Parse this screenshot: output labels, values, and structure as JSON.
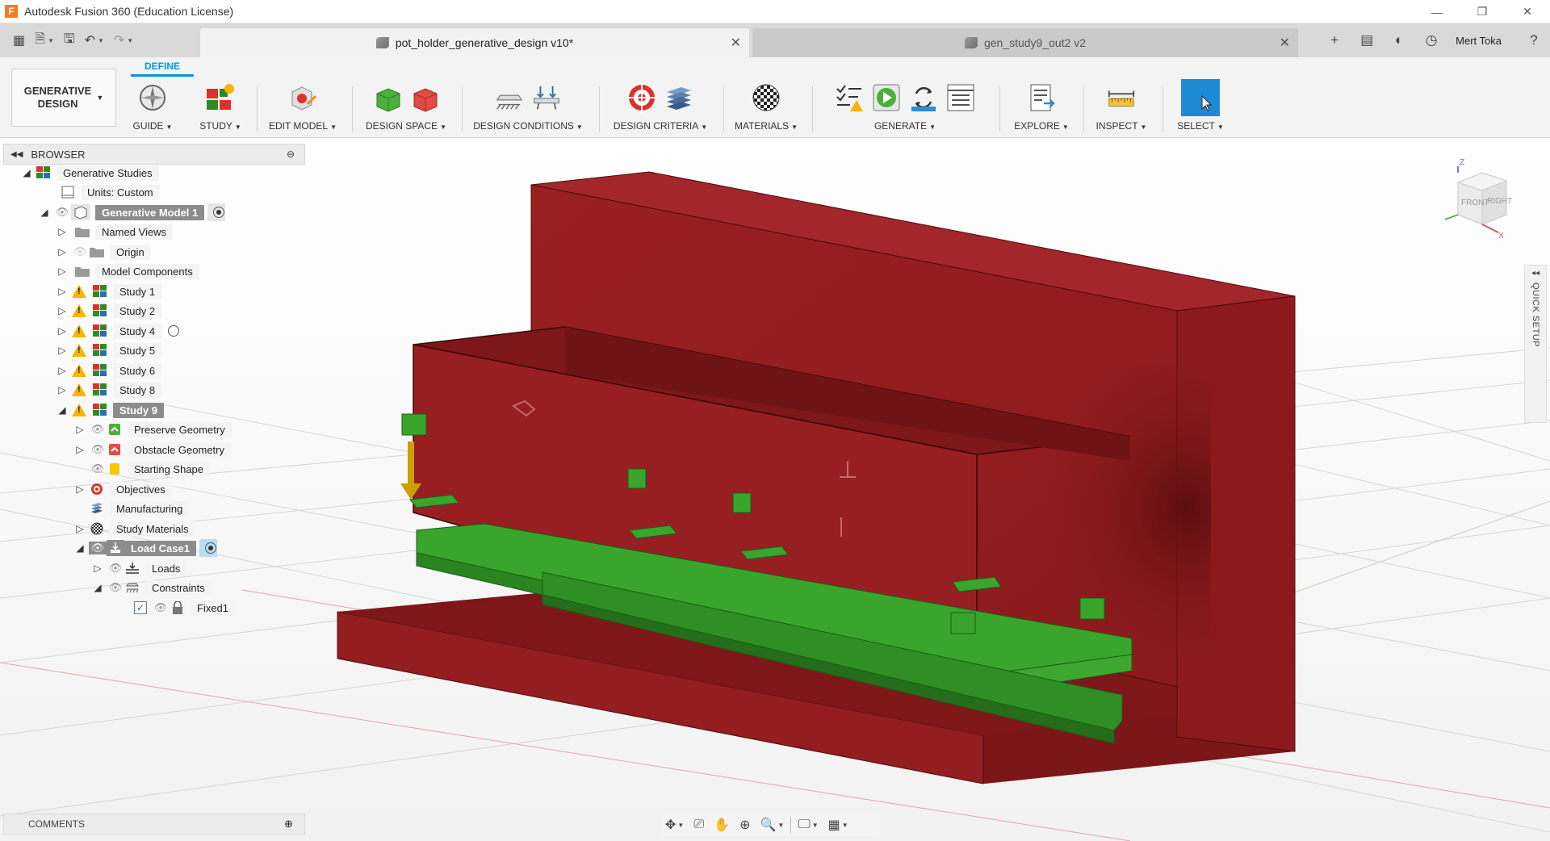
{
  "window": {
    "title": "Autodesk Fusion 360 (Education License)",
    "logo_letter": "F",
    "controls": [
      "—",
      "❐",
      "✕"
    ]
  },
  "quick_access": {
    "grid_icon": "▦",
    "file_icon": "🗎",
    "save_icon": "🖫",
    "undo_icon": "↶",
    "redo_icon": "↷"
  },
  "tabs": [
    {
      "label": "pot_holder_generative_design v10*",
      "active": true,
      "close": "✕"
    },
    {
      "label": "gen_study9_out2 v2",
      "active": false,
      "close": "✕"
    }
  ],
  "topright": {
    "add_icon": "+",
    "comment_icon": "▤",
    "job_icon": "◐",
    "clock_icon": "◷",
    "user_name": "Mert Toka",
    "help_icon": "?"
  },
  "ribbon": {
    "workspace_line1": "GENERATIVE",
    "workspace_line2": "DESIGN",
    "active_tab": "DEFINE",
    "groups": [
      {
        "label": "GUIDE"
      },
      {
        "label": "STUDY"
      },
      {
        "label": "EDIT MODEL"
      },
      {
        "label": "DESIGN SPACE"
      },
      {
        "label": "DESIGN CONDITIONS"
      },
      {
        "label": "DESIGN CRITERIA"
      },
      {
        "label": "MATERIALS"
      },
      {
        "label": "GENERATE"
      },
      {
        "label": "EXPLORE"
      },
      {
        "label": "INSPECT"
      },
      {
        "label": "SELECT"
      }
    ]
  },
  "browser": {
    "title": "BROWSER",
    "items": [
      {
        "label": "Generative Studies"
      },
      {
        "label": "Units: Custom"
      },
      {
        "label": "Generative Model 1"
      },
      {
        "label": "Named Views"
      },
      {
        "label": "Origin"
      },
      {
        "label": "Model Components"
      },
      {
        "label": "Study 1"
      },
      {
        "label": "Study 2"
      },
      {
        "label": "Study 4"
      },
      {
        "label": "Study 5"
      },
      {
        "label": "Study 6"
      },
      {
        "label": "Study 8"
      },
      {
        "label": "Study 9"
      },
      {
        "label": "Preserve Geometry"
      },
      {
        "label": "Obstacle Geometry"
      },
      {
        "label": "Starting Shape"
      },
      {
        "label": "Objectives"
      },
      {
        "label": "Manufacturing"
      },
      {
        "label": "Study Materials"
      },
      {
        "label": "Load Case1"
      },
      {
        "label": "Loads"
      },
      {
        "label": "Constraints"
      },
      {
        "label": "Fixed1"
      }
    ]
  },
  "viewcube": {
    "front": "FRONT",
    "right": "RIGHT",
    "axis_z": "Z",
    "axis_x": "X"
  },
  "quick_setup": {
    "label": "QUICK SETUP",
    "arrow": "◂◂"
  },
  "comments": {
    "label": "COMMENTS",
    "add": "⊕"
  },
  "colors": {
    "obstacle": "#8e1c1e",
    "preserve": "#2e8b23",
    "load_arrow": "#c9a100",
    "accent": "#0696d7"
  }
}
